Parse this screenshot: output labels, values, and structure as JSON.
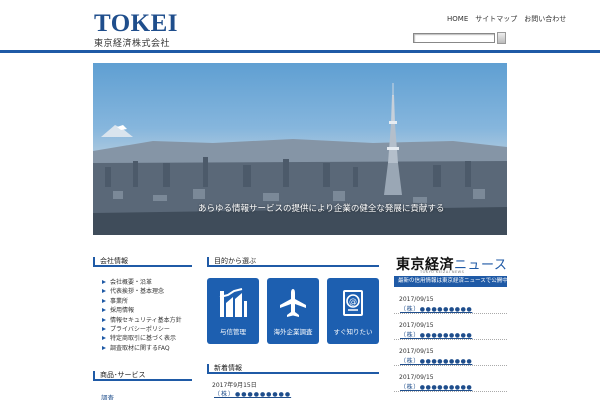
{
  "header": {
    "logo": "TOKEI",
    "company": "東京経済株式会社",
    "top_links": "HOME　サイトマップ　お問い合わせ",
    "search": {
      "value": "",
      "button": ""
    }
  },
  "hero": {
    "caption": "あらゆる情報サービスの提供により企業の健全な発展に貢献する"
  },
  "company_section": {
    "heading": "会社情報",
    "items": [
      "会社概要・沿革",
      "代表挨拶・基本理念",
      "事業所",
      "採用情報",
      "情報セキュリティ基本方針",
      "プライバシーポリシー",
      "特定商取引に基づく表示",
      "調査取材に関するFAQ"
    ]
  },
  "products_section": {
    "heading": "商品･サービス",
    "first_item": "調査"
  },
  "purpose_section": {
    "heading": "目的から選ぶ",
    "tiles": [
      {
        "label": "与信管理",
        "icon": "building-chart-icon"
      },
      {
        "label": "海外企業調査",
        "icon": "airplane-icon"
      },
      {
        "label": "すぐ知りたい",
        "icon": "instant-report-icon"
      }
    ]
  },
  "news_section": {
    "heading": "新着情報",
    "items": [
      {
        "date": "2017年9月15日",
        "text": "（株）●●●●●●●●●"
      }
    ]
  },
  "tsr_news": {
    "title_kanji": "東京経済",
    "title_kana": "ニュース",
    "subtitle": "TOKYO KEIZAI NEWS",
    "bar_text": "最新の信用情報は東京経済ニュースで公開中",
    "items": [
      {
        "date": "2017/09/15",
        "text": "（株）●●●●●●●●●"
      },
      {
        "date": "2017/09/15",
        "text": "（株）●●●●●●●●●"
      },
      {
        "date": "2017/09/15",
        "text": "（株）●●●●●●●●●"
      },
      {
        "date": "2017/09/15",
        "text": "（株）●●●●●●●●●"
      }
    ]
  },
  "colors": {
    "brand_blue": "#1f5aa6",
    "tile_blue": "#1d5fb0",
    "logo_blue": "#1f4e8c"
  }
}
